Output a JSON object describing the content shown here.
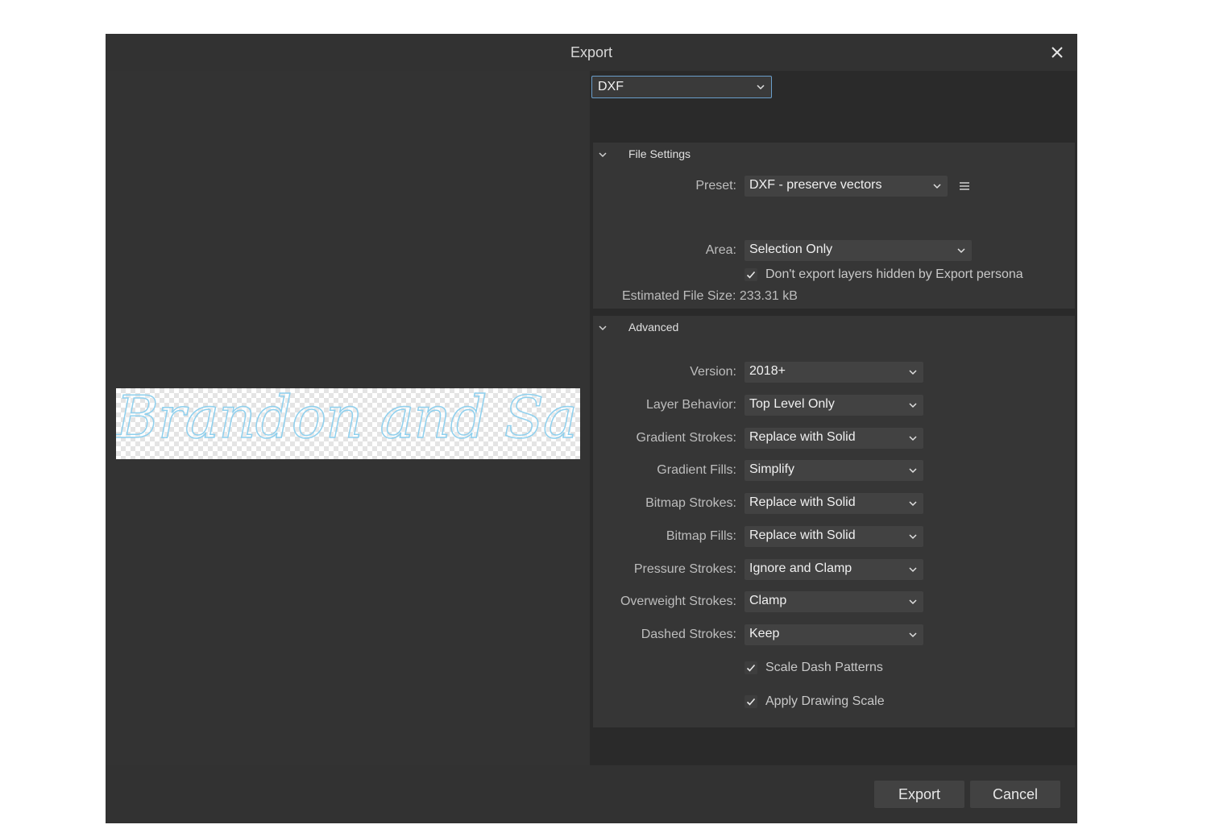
{
  "dialog": {
    "title": "Export",
    "close_icon": "close-icon"
  },
  "preview": {
    "text": "Brandon and Sarah"
  },
  "format": {
    "selected": "DXF"
  },
  "file_settings": {
    "title": "File Settings",
    "preset_label": "Preset:",
    "preset_value": "DXF - preserve vectors",
    "area_label": "Area:",
    "area_value": "Selection Only",
    "hidden_layers_label": "Don't export layers hidden by Export persona",
    "hidden_layers_checked": true,
    "estimated_size": "Estimated File Size: 233.31 kB"
  },
  "advanced": {
    "title": "Advanced",
    "rows": [
      {
        "label": "Version:",
        "value": "2018+"
      },
      {
        "label": "Layer Behavior:",
        "value": "Top Level Only"
      },
      {
        "label": "Gradient Strokes:",
        "value": "Replace with Solid"
      },
      {
        "label": "Gradient Fills:",
        "value": "Simplify"
      },
      {
        "label": "Bitmap Strokes:",
        "value": "Replace with Solid"
      },
      {
        "label": "Bitmap Fills:",
        "value": "Replace with Solid"
      },
      {
        "label": "Pressure Strokes:",
        "value": "Ignore and Clamp"
      },
      {
        "label": "Overweight Strokes:",
        "value": "Clamp"
      },
      {
        "label": "Dashed Strokes:",
        "value": "Keep"
      }
    ],
    "scale_dash_label": "Scale Dash Patterns",
    "scale_dash_checked": true,
    "drawing_scale_label": "Apply Drawing Scale",
    "drawing_scale_checked": true
  },
  "footer": {
    "export_label": "Export",
    "cancel_label": "Cancel"
  },
  "colors": {
    "dialog_bg": "#323232",
    "accent_border": "#6a9ecb",
    "preview_stroke": "#8fd0ee"
  }
}
